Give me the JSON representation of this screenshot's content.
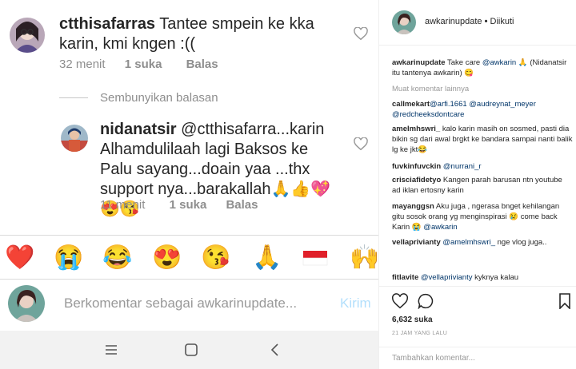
{
  "mobile": {
    "comment": {
      "username": "ctthisafarras",
      "text": " Tantee smpein ke kka karin, kmi kngen :((",
      "time": "32 menit",
      "likes": "1 suka",
      "reply": "Balas"
    },
    "hide_replies": "Sembunyikan balasan",
    "reply_comment": {
      "username": "nidanatsir",
      "mention": "@ctthisafarra",
      "text": "...karin Alhamdulilaah lagi Baksos ke Palu sayang...doain yaa ...thx support nya...barakallah🙏👍💖😍😘",
      "time": "11 menit",
      "likes": "1 suka",
      "reply": "Balas"
    },
    "emoji_bar": [
      "❤️",
      "😭",
      "😂",
      "😍",
      "😘",
      "🙏",
      "🇮🇩",
      "🙌"
    ],
    "composer": {
      "placeholder": "Berkomentar sebagai awkarinupdate...",
      "post_label": "Kirim"
    }
  },
  "desktop": {
    "header": {
      "username": "awkarinupdate",
      "separator": "•",
      "follow_status": "Diikuti"
    },
    "caption": {
      "username": "awkarinupdate",
      "text": " Take care ",
      "mention": "@awkarin",
      "rest": " 🙏 (Nidanatsir itu tantenya awkarin) 😋"
    },
    "load_more": "Muat komentar lainnya",
    "comments": [
      {
        "user": "callmekart",
        "parts": [
          [
            "m",
            "@arfi.1661"
          ],
          [
            "t",
            " "
          ],
          [
            "m",
            "@audreynat_meyer"
          ],
          [
            "t",
            " "
          ],
          [
            "m",
            "@redcheeksdontcare"
          ]
        ]
      },
      {
        "user": "amelmhswri_",
        "parts": [
          [
            "t",
            " kalo karin masih on sosmed, pasti dia bikin sg dari awal brgkt ke bandara sampai nanti balik lg ke jkt😂"
          ]
        ]
      },
      {
        "user": "fuvkinfuvckin",
        "parts": [
          [
            "t",
            " "
          ],
          [
            "m",
            "@nurrani_r"
          ]
        ]
      },
      {
        "user": "crisciafidetyo",
        "parts": [
          [
            "t",
            " Kangen parah barusan ntn youtube ad iklan ertosny karin"
          ]
        ]
      },
      {
        "user": "mayanggsn",
        "parts": [
          [
            "t",
            " Aku juga , ngerasa bnget kehilangan gitu sosok orang yg menginspirasi 😢 come back Karin 😭 "
          ],
          [
            "m",
            "@awkarin"
          ]
        ]
      },
      {
        "user": "vellaprivianty",
        "parts": [
          [
            "t",
            " "
          ],
          [
            "m",
            "@amelmhswri_"
          ],
          [
            "t",
            " nge vlog juga.."
          ]
        ]
      },
      {
        "user": "fitlavite",
        "parts": [
          [
            "t",
            " "
          ],
          [
            "m",
            "@vellaprivianty"
          ],
          [
            "t",
            " kyknya kalau"
          ]
        ]
      }
    ],
    "likes": "6,632 suka",
    "timestamp": "21 JAM YANG LALU",
    "add_comment_placeholder": "Tambahkan komentar..."
  },
  "colors": {
    "text": "#262626",
    "muted": "#8e8e8e",
    "mention": "#003569",
    "post_button": "#b2dffc",
    "divider": "#dbdbdb"
  },
  "icons": [
    "heart-icon",
    "comment-icon",
    "bookmark-icon",
    "nav-recents-icon",
    "nav-home-icon",
    "nav-back-icon"
  ]
}
